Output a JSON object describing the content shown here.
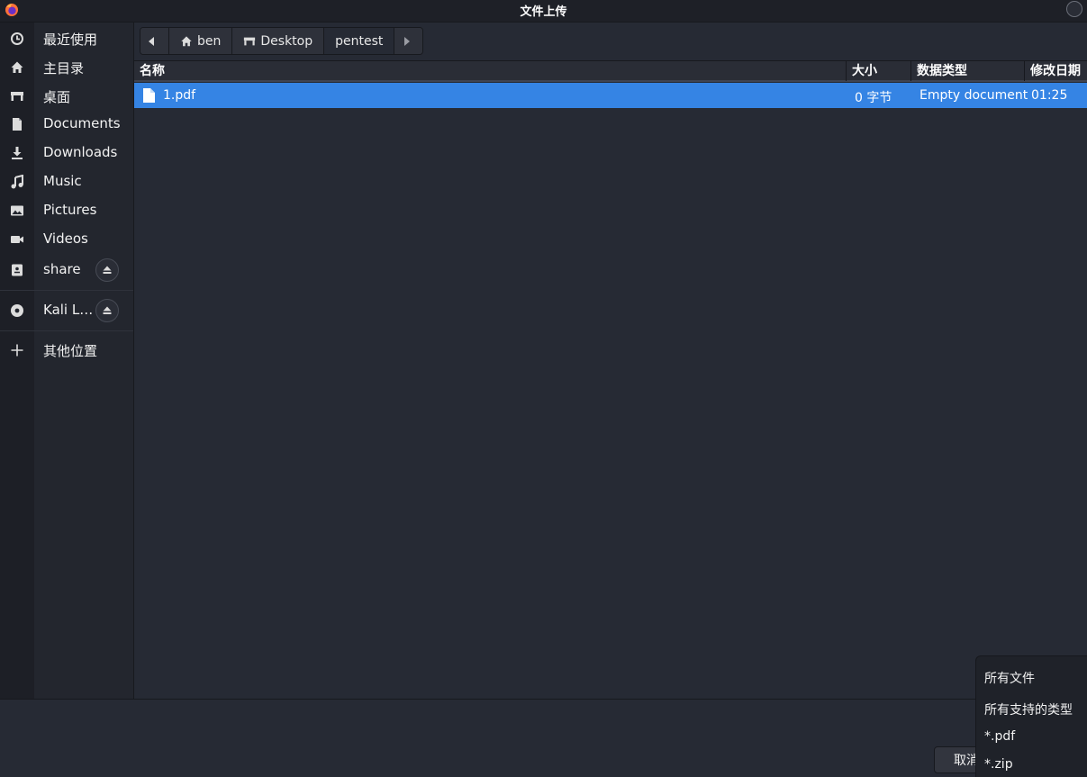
{
  "window": {
    "title": "文件上传",
    "app_icon": "firefox-icon",
    "accent": "#3584e4"
  },
  "sidebar": {
    "items": [
      {
        "label": "最近使用",
        "icon": "clock-icon"
      },
      {
        "label": "主目录",
        "icon": "home-icon"
      },
      {
        "label": "桌面",
        "icon": "desktop-icon"
      },
      {
        "label": "Documents",
        "icon": "document-icon"
      },
      {
        "label": "Downloads",
        "icon": "download-icon"
      },
      {
        "label": "Music",
        "icon": "music-icon"
      },
      {
        "label": "Pictures",
        "icon": "picture-icon"
      },
      {
        "label": "Videos",
        "icon": "video-icon"
      },
      {
        "label": "share",
        "icon": "drive-icon"
      },
      {
        "label": "Kali L…",
        "icon": "disc-icon"
      },
      {
        "label": "其他位置",
        "icon": "plus-icon"
      }
    ]
  },
  "pathbar": {
    "segments": [
      "ben",
      "Desktop",
      "pentest"
    ]
  },
  "columns": {
    "name": "名称",
    "size": "大小",
    "type": "数据类型",
    "modified": "修改日期"
  },
  "files": [
    {
      "name": "1.pdf",
      "size": "0 字节",
      "type": "Empty document",
      "modified": "01:25"
    }
  ],
  "footer": {
    "cancel_label": "取消"
  },
  "filter_popup": {
    "options": [
      "所有文件",
      "所有支持的类型",
      "*.pdf",
      "*.zip"
    ]
  }
}
